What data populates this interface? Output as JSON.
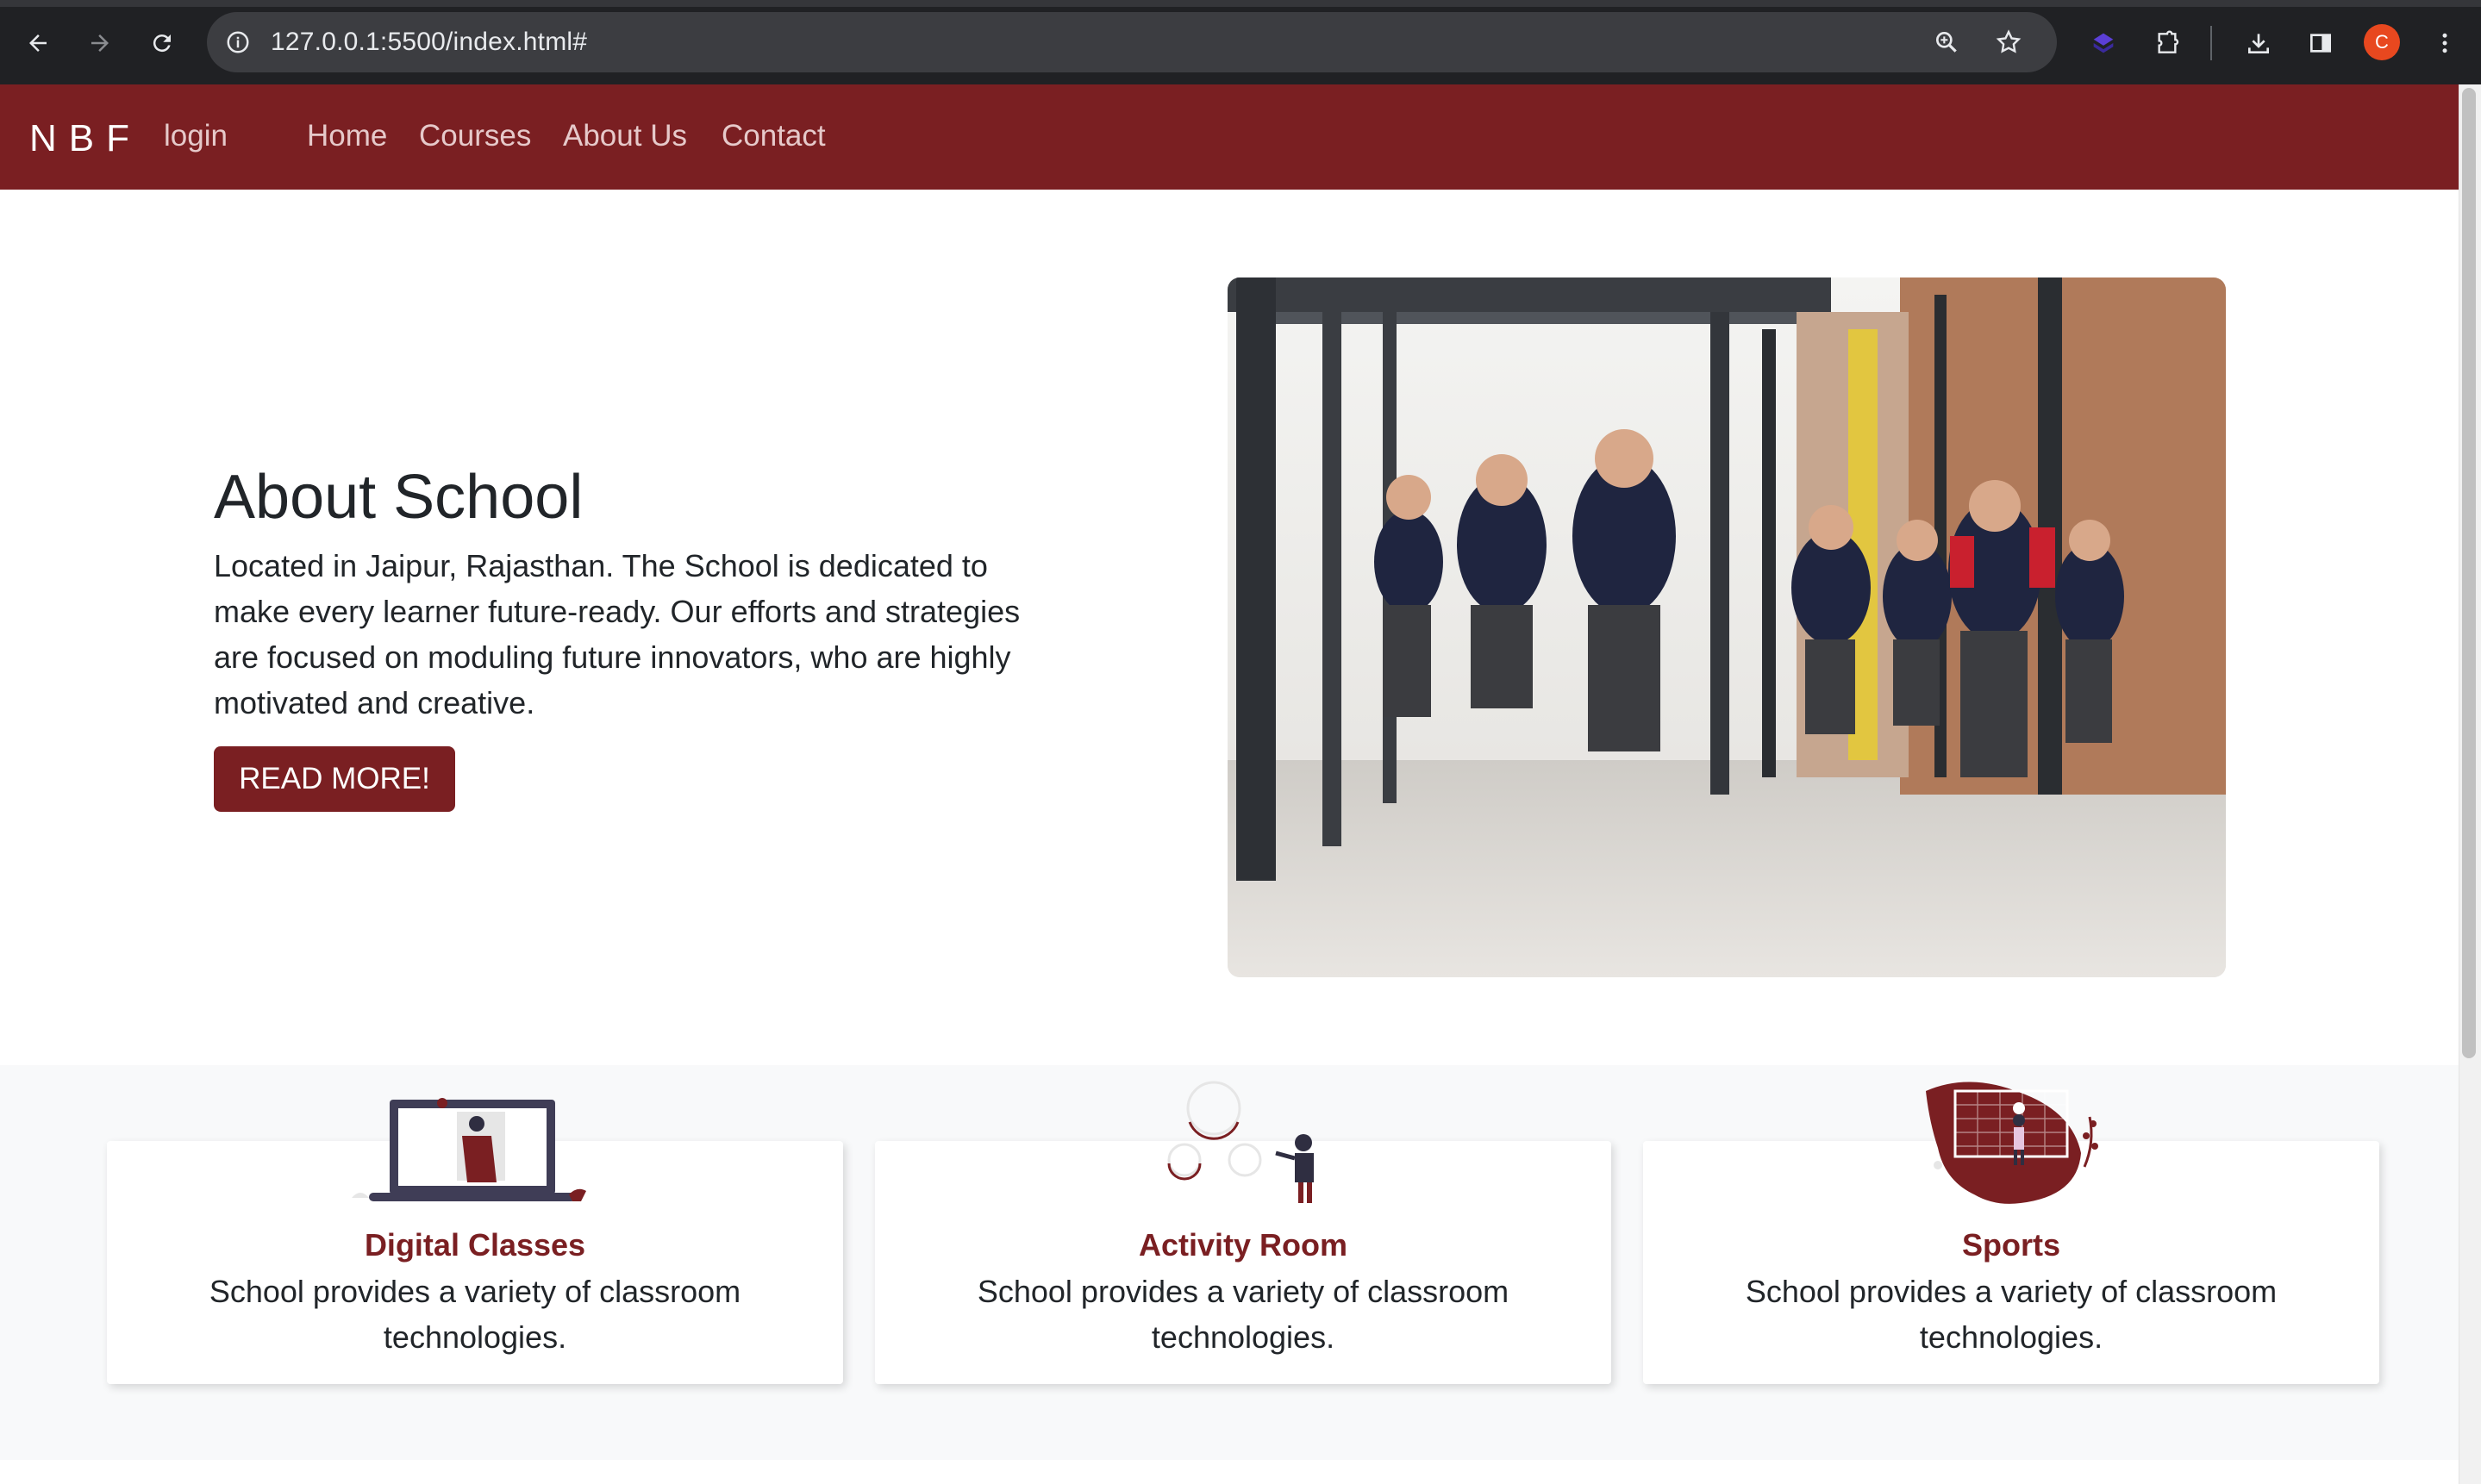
{
  "browser": {
    "url": "127.0.0.1:5500/index.html#",
    "profile_initial": "C",
    "icons": [
      "back-icon",
      "forward-icon",
      "reload-icon",
      "site-info-icon",
      "zoom-icon",
      "bookmark-star-icon",
      "extension-icon",
      "puzzle-icon",
      "download-icon",
      "side-panel-icon",
      "menu-icon"
    ]
  },
  "navbar": {
    "brand": "NBF",
    "login": "login",
    "links": [
      "Home",
      "Courses",
      "About Us",
      "Contact"
    ]
  },
  "hero": {
    "title": "About School",
    "text": "Located in Jaipur, Rajasthan. The School is dedicated to make every learner future-ready. Our efforts and strategies are focused on moduling future innovators, who are highly motivated and creative.",
    "button": "READ MORE!"
  },
  "features": [
    {
      "title": "Digital Classes",
      "text": "School provides a variety of classroom technologies."
    },
    {
      "title": "Activity Room",
      "text": "School provides a variety of classroom technologies."
    },
    {
      "title": "Sports",
      "text": "School provides a variety of classroom technologies."
    }
  ],
  "colors": {
    "brand": "#7a1f22",
    "nav_link": "#e6c9ca",
    "chrome": "#202124"
  }
}
